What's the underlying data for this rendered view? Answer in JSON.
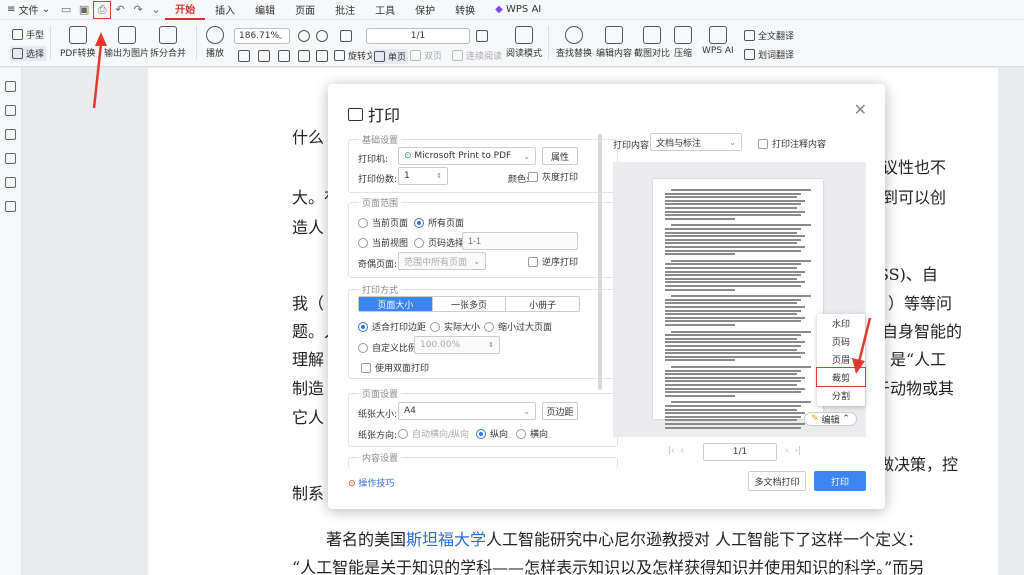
{
  "menubar": {
    "file_label": "文件",
    "tabs": [
      "开始",
      "插入",
      "编辑",
      "页面",
      "批注",
      "工具",
      "保护",
      "转换",
      "WPS AI"
    ],
    "active_tab": "开始"
  },
  "ribbon": {
    "hand_tool": "手型",
    "select_tool": "选择",
    "pdf_convert": "PDF转换",
    "export_image": "输出为图片",
    "split_merge": "拆分合并",
    "play": "播放",
    "zoom_value": "186.71%",
    "page_value": "1/1",
    "rotate_doc": "旋转文档",
    "single_page": "单页",
    "double_page": "双页",
    "continuous_read": "连续阅读",
    "read_mode": "阅读模式",
    "find_replace": "查找替换",
    "edit_content": "编辑内容",
    "crop_compare": "截图对比",
    "compress": "压缩",
    "wps_ai": "WPS AI",
    "full_translate": "全文翻译",
    "word_translate": "划词翻译"
  },
  "document": {
    "lines": [
      "什么",
      "争议性也不",
      "大。有",
      "所到可以创",
      "造人",
      "SS)、自",
      "我（",
      "）等等问",
      "题。人",
      "自身智能的",
      "理解",
      "是“人工",
      "制造",
      "于动物或其",
      "它人",
      "做决策，控",
      "制系",
      "著名的美国",
      "斯坦福大学",
      "人工智能研究中心尼尔逊教授对 人工智能下了这样一个定义：",
      "“人工智能是关于知识的学科——怎样表示知识以及怎样获得知识并使用知识的科学。”而另"
    ]
  },
  "dialog": {
    "title": "打印",
    "basic_settings": "基础设置",
    "printer_label": "打印机:",
    "printer_value": "Microsoft Print to PDF",
    "properties": "属性",
    "copies_label": "打印份数:",
    "copies_value": "1",
    "color_label": "颜色:",
    "grayscale": "灰度打印",
    "page_range": "页面范围",
    "current_page": "当前页面",
    "all_pages": "所有页面",
    "current_view": "当前视图",
    "page_select": "页码选择:",
    "page_select_placeholder": "1-1",
    "odd_even_label": "奇偶页面:",
    "odd_even_value": "范围中所有页面",
    "reverse_print": "逆序打印",
    "print_mode": "打印方式",
    "mode_tabs": [
      "页面大小",
      "一张多页",
      "小册子"
    ],
    "fit_margin": "适合打印边距",
    "actual_size": "实际大小",
    "shrink_large": "缩小过大页面",
    "custom_scale": "自定义比例",
    "scale_value": "100.00%",
    "duplex": "使用双面打印",
    "page_settings": "页面设置",
    "paper_size_label": "纸张大小:",
    "paper_size_value": "A4",
    "page_margin": "页边距",
    "orientation_label": "纸张方向:",
    "auto_orientation": "自动横向/纵向",
    "portrait": "纵向",
    "landscape": "横向",
    "content_settings": "内容设置",
    "tips": "操作技巧",
    "print_content_label": "打印内容:",
    "print_content_value": "文档与标注",
    "print_annotations": "打印注释内容",
    "menu_items": [
      "水印",
      "页码",
      "页眉",
      "裁剪",
      "分割"
    ],
    "highlighted_menu_item": "裁剪",
    "edit_button": "编辑",
    "preview_page": "1/1",
    "multi_doc_print": "多文档打印",
    "print_button": "打印"
  },
  "colors": {
    "accent": "#3b86f0",
    "active_tab": "#d0342c",
    "annotation": "#e03a2e"
  }
}
